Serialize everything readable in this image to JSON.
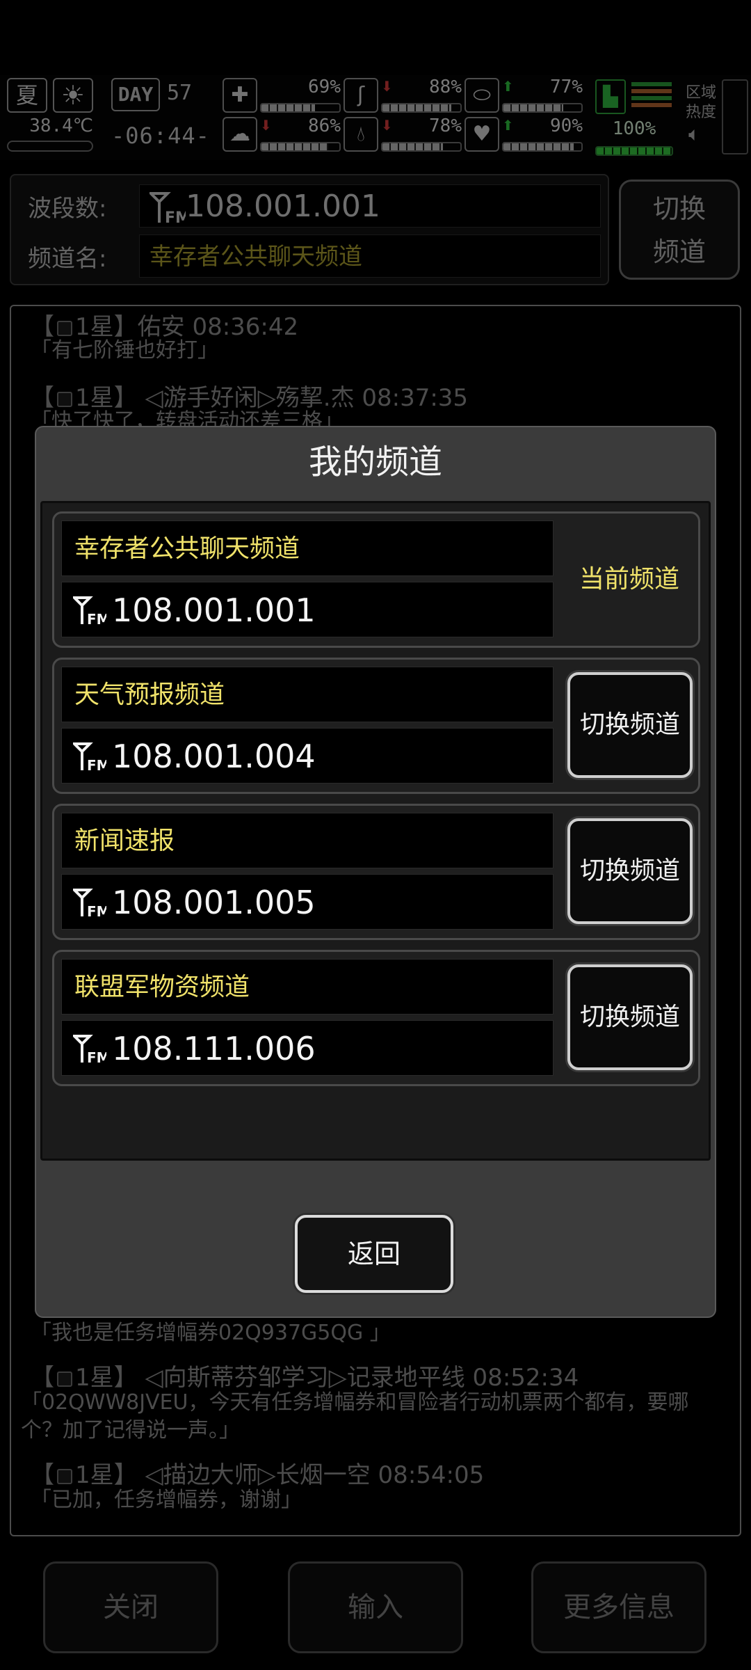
{
  "status": {
    "season": "夏",
    "temperature": "38.4℃",
    "day_label": "DAY",
    "day_number": "57",
    "time": "-06:44-",
    "stats": [
      {
        "id": "health",
        "icon": "medkit-icon",
        "arrow": "",
        "arrow_color": "",
        "value": "69%",
        "fill": 0.69
      },
      {
        "id": "hunger",
        "icon": "stomach-icon",
        "arrow": "down",
        "arrow_color": "#d23a3a",
        "value": "88%",
        "fill": 0.88
      },
      {
        "id": "stamina",
        "icon": "capsule-icon",
        "arrow": "up",
        "arrow_color": "#2fbf3f",
        "value": "77%",
        "fill": 0.77
      },
      {
        "id": "mood",
        "icon": "brain-icon",
        "arrow": "down",
        "arrow_color": "#d23a3a",
        "value": "86%",
        "fill": 0.86
      },
      {
        "id": "water",
        "icon": "water-drop-icon",
        "arrow": "down",
        "arrow_color": "#d23a3a",
        "value": "78%",
        "fill": 0.78
      },
      {
        "id": "heart",
        "icon": "heart-icon",
        "arrow": "up",
        "arrow_color": "#2fbf3f",
        "value": "90%",
        "fill": 0.9
      }
    ],
    "energy_value": "100%",
    "energy_fill": 1.0,
    "zone_label_1": "区域",
    "zone_label_2": "热度"
  },
  "radio": {
    "band_label": "波段数:",
    "band_value": "108.001.001",
    "channel_label": "频道名:",
    "channel_value": "幸存者公共聊天频道",
    "switch_line1": "切换",
    "switch_line2": "频道"
  },
  "chat": {
    "messages_top": [
      {
        "stars": "【",
        "rank": "1星】",
        "user": "佑安 08:36:42",
        "text": "「有七阶锤也好打」"
      },
      {
        "stars": "【",
        "rank": "1星】",
        "user": " ◁游手好闲▷殇挈.杰 08:37:35",
        "text": "「快了快了，转盘活动还差三格」"
      }
    ],
    "messages_bottom": [
      {
        "text": "「我也是任务增幅券02Q937G5QG 」"
      },
      {
        "stars": "【",
        "rank": "1星】",
        "user": " ◁向斯蒂芬邹学习▷记录地平线 08:52:34",
        "text": "「02QWW8JVEU，今天有任务增幅券和冒险者行动机票两个都有，要哪个？加了记得说一声。」"
      },
      {
        "stars": "【",
        "rank": "1星】",
        "user": " ◁描边大师▷长烟一空 08:54:05",
        "text": "「已加，任务增幅券，谢谢」"
      }
    ]
  },
  "bottom": {
    "close": "关闭",
    "input": "输入",
    "more": "更多信息"
  },
  "modal": {
    "title": "我的频道",
    "channels": [
      {
        "name": "幸存者公共聊天频道",
        "freq": "108.001.001",
        "current": true,
        "current_label": "当前频道"
      },
      {
        "name": "天气预报频道",
        "freq": "108.001.004",
        "current": false,
        "switch_label": "切换频道"
      },
      {
        "name": "新闻速报",
        "freq": "108.001.005",
        "current": false,
        "switch_label": "切换频道"
      },
      {
        "name": "联盟军物资频道",
        "freq": "108.111.006",
        "current": false,
        "switch_label": "切换频道"
      }
    ],
    "back": "返回"
  }
}
